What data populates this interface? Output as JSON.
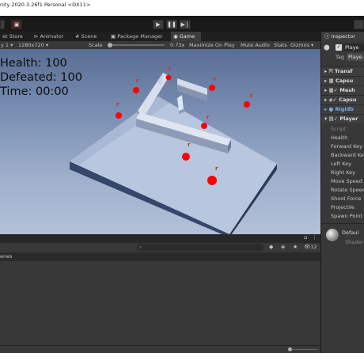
{
  "window": {
    "title": "nity 2020.3.26f1 Personal <DX11>"
  },
  "toolbar": {
    "play_icon": "play-icon",
    "pause_icon": "pause-icon",
    "step_icon": "step-icon"
  },
  "tabs": [
    {
      "label": "et Store"
    },
    {
      "label": "Animator"
    },
    {
      "label": "Scene"
    },
    {
      "label": "Package Manager"
    },
    {
      "label": "Game"
    }
  ],
  "game_toolbar": {
    "display": "y 1",
    "resolution": "1280x720",
    "scale_label": "Scale",
    "scale_value": "0.73x",
    "maximize": "Maximize On Play",
    "mute": "Mute Audio",
    "stats": "Stats",
    "gizmos": "Gizmos"
  },
  "hud": {
    "health": "Health: 100",
    "defeated": "Defeated: 100",
    "time": "Time:  00:00"
  },
  "scene": {
    "enemy_label": "r",
    "enemy_color": "#ff0000",
    "floor_color": "#b9c7e0"
  },
  "project": {
    "count": "12"
  },
  "console": {
    "label": "enes"
  },
  "inspector": {
    "tab": "Inspector",
    "object_name": "Playe",
    "tag_label": "Tag",
    "tag_value": "Playe",
    "components": [
      {
        "label": "Transf"
      },
      {
        "label": "Capsu"
      },
      {
        "label": "Mesh"
      },
      {
        "label": "Capsu"
      },
      {
        "label": "Rigidb"
      },
      {
        "label": "Player"
      }
    ],
    "fields": [
      "Script",
      "Health",
      "Forward Key",
      "Backward Key",
      "Left Key",
      "Right Key",
      "Move Speed",
      "Rotate Speed",
      "Shoot Force",
      "Projectile",
      "Spawn Point"
    ],
    "material": "Defaul",
    "shader": "Shader"
  }
}
